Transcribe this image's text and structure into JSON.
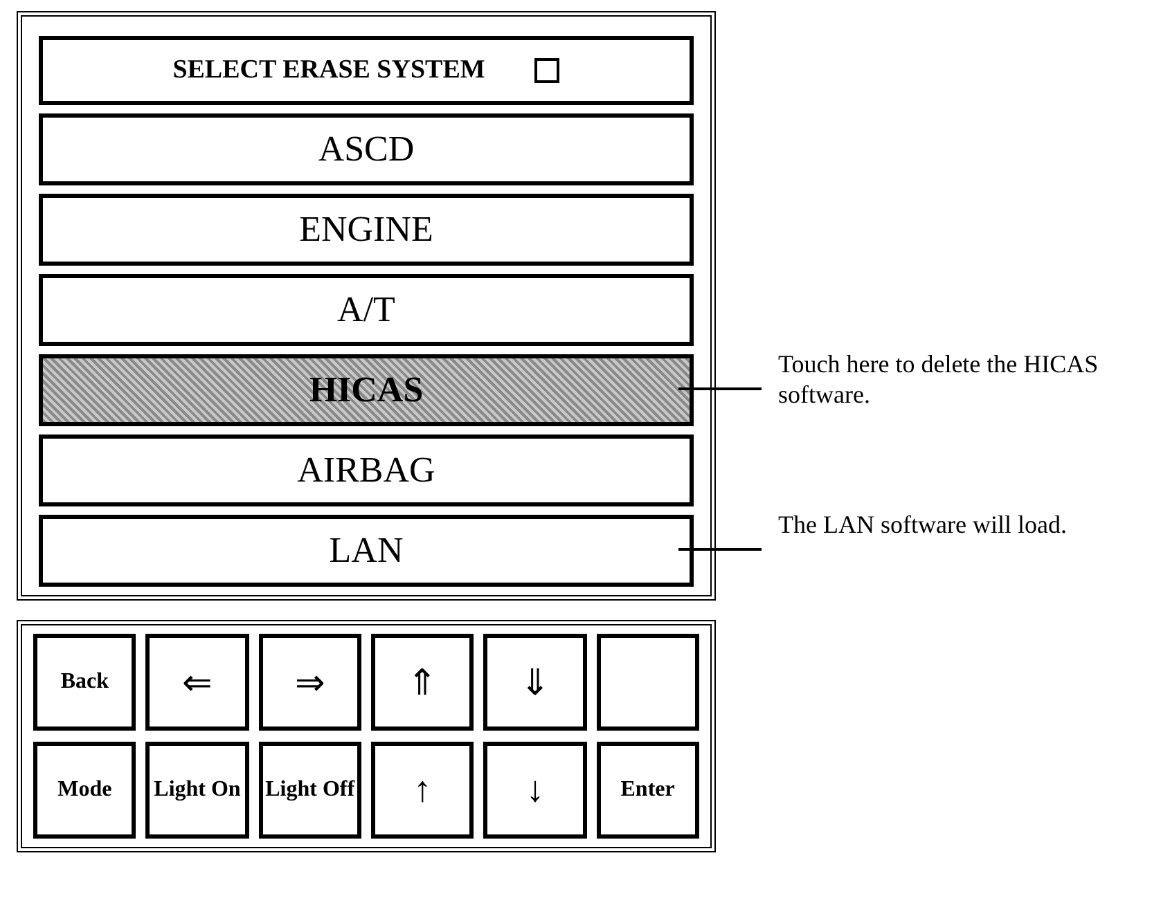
{
  "header": {
    "title": "SELECT ERASE SYSTEM",
    "checkbox": {
      "checked": false
    }
  },
  "systems": [
    {
      "label": "ASCD",
      "selected": false
    },
    {
      "label": "ENGINE",
      "selected": false
    },
    {
      "label": "A/T",
      "selected": false
    },
    {
      "label": "HICAS",
      "selected": true,
      "callout": "Touch here to delete the HICAS software."
    },
    {
      "label": "AIRBAG",
      "selected": false
    },
    {
      "label": "LAN",
      "selected": false,
      "callout": "The LAN software will load."
    }
  ],
  "keypad": [
    [
      {
        "kind": "word",
        "label": "Back"
      },
      {
        "kind": "symbol",
        "label": "⇐"
      },
      {
        "kind": "symbol",
        "label": "⇒"
      },
      {
        "kind": "symbol",
        "label": "⇑"
      },
      {
        "kind": "symbol",
        "label": "⇓"
      },
      {
        "kind": "blank"
      }
    ],
    [
      {
        "kind": "word",
        "label": "Mode"
      },
      {
        "kind": "word",
        "label": "Light On"
      },
      {
        "kind": "word",
        "label": "Light Off"
      },
      {
        "kind": "symbol",
        "label": "↑"
      },
      {
        "kind": "symbol",
        "label": "↓"
      },
      {
        "kind": "word",
        "label": "Enter"
      }
    ]
  ]
}
